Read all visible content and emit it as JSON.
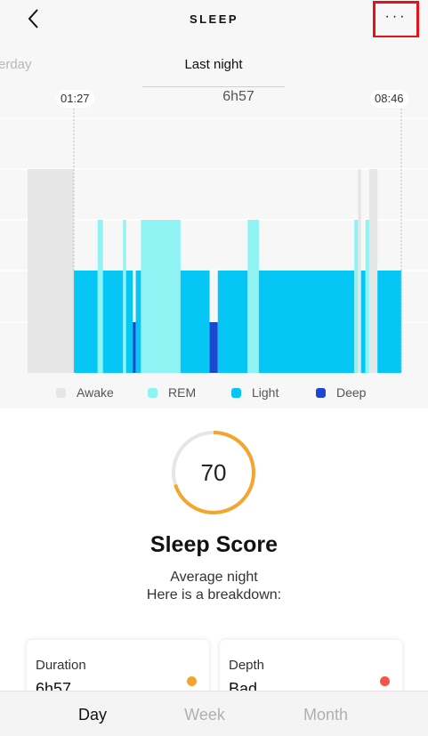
{
  "header": {
    "title": "SLEEP",
    "back_icon": "chevron-left-icon",
    "more_icon": "ellipsis-icon",
    "more_label": "···"
  },
  "day_tabs": {
    "previous": "erday",
    "current": "Last night"
  },
  "sleep_summary": {
    "bed_time": "01:27",
    "wake_time": "08:46",
    "duration": "6h57"
  },
  "chart_data": {
    "type": "area",
    "categories": [
      "Awake",
      "REM",
      "Light",
      "Deep"
    ],
    "colors": {
      "Awake": "#e6e6e6",
      "REM": "#8ff3f3",
      "Light": "#06c6f5",
      "Deep": "#1d47cf"
    },
    "segments": [
      {
        "stage": "Awake",
        "start": "00:25",
        "end": "01:27"
      },
      {
        "stage": "Light",
        "start": "01:27",
        "end": "01:59"
      },
      {
        "stage": "REM",
        "start": "01:59",
        "end": "02:06"
      },
      {
        "stage": "Light",
        "start": "02:06",
        "end": "02:33"
      },
      {
        "stage": "REM",
        "start": "02:33",
        "end": "02:37"
      },
      {
        "stage": "Light",
        "start": "02:37",
        "end": "02:46"
      },
      {
        "stage": "Deep",
        "start": "02:46",
        "end": "02:50"
      },
      {
        "stage": "Light",
        "start": "02:50",
        "end": "02:57"
      },
      {
        "stage": "REM",
        "start": "02:57",
        "end": "03:50"
      },
      {
        "stage": "Light",
        "start": "03:50",
        "end": "04:29"
      },
      {
        "stage": "Deep",
        "start": "04:29",
        "end": "04:40"
      },
      {
        "stage": "Light",
        "start": "04:40",
        "end": "05:20"
      },
      {
        "stage": "REM",
        "start": "05:20",
        "end": "05:35"
      },
      {
        "stage": "Light",
        "start": "05:35",
        "end": "07:43"
      },
      {
        "stage": "REM",
        "start": "07:43",
        "end": "07:48"
      },
      {
        "stage": "Awake",
        "start": "07:48",
        "end": "07:52"
      },
      {
        "stage": "Light",
        "start": "07:52",
        "end": "07:58"
      },
      {
        "stage": "REM",
        "start": "07:58",
        "end": "08:03"
      },
      {
        "stage": "Awake",
        "start": "08:03",
        "end": "08:14"
      },
      {
        "stage": "Light",
        "start": "08:14",
        "end": "08:46"
      }
    ],
    "grid": true,
    "legend_position": "bottom"
  },
  "score": {
    "value": "70",
    "fraction": 0.7,
    "title": "Sleep Score",
    "subtitle_line1": "Average night",
    "subtitle_line2": "Here is a breakdown:",
    "ring_color": "#f5a52d",
    "track_color": "#e6e6e6"
  },
  "cards": [
    {
      "label": "Duration",
      "value": "6h57",
      "dot_color": "#f5a52d"
    },
    {
      "label": "Depth",
      "value": "Bad",
      "dot_color": "#f4574a"
    }
  ],
  "bottom_nav": {
    "items": [
      {
        "label": "Day",
        "active": true
      },
      {
        "label": "Week",
        "active": false
      },
      {
        "label": "Month",
        "active": false
      }
    ]
  }
}
